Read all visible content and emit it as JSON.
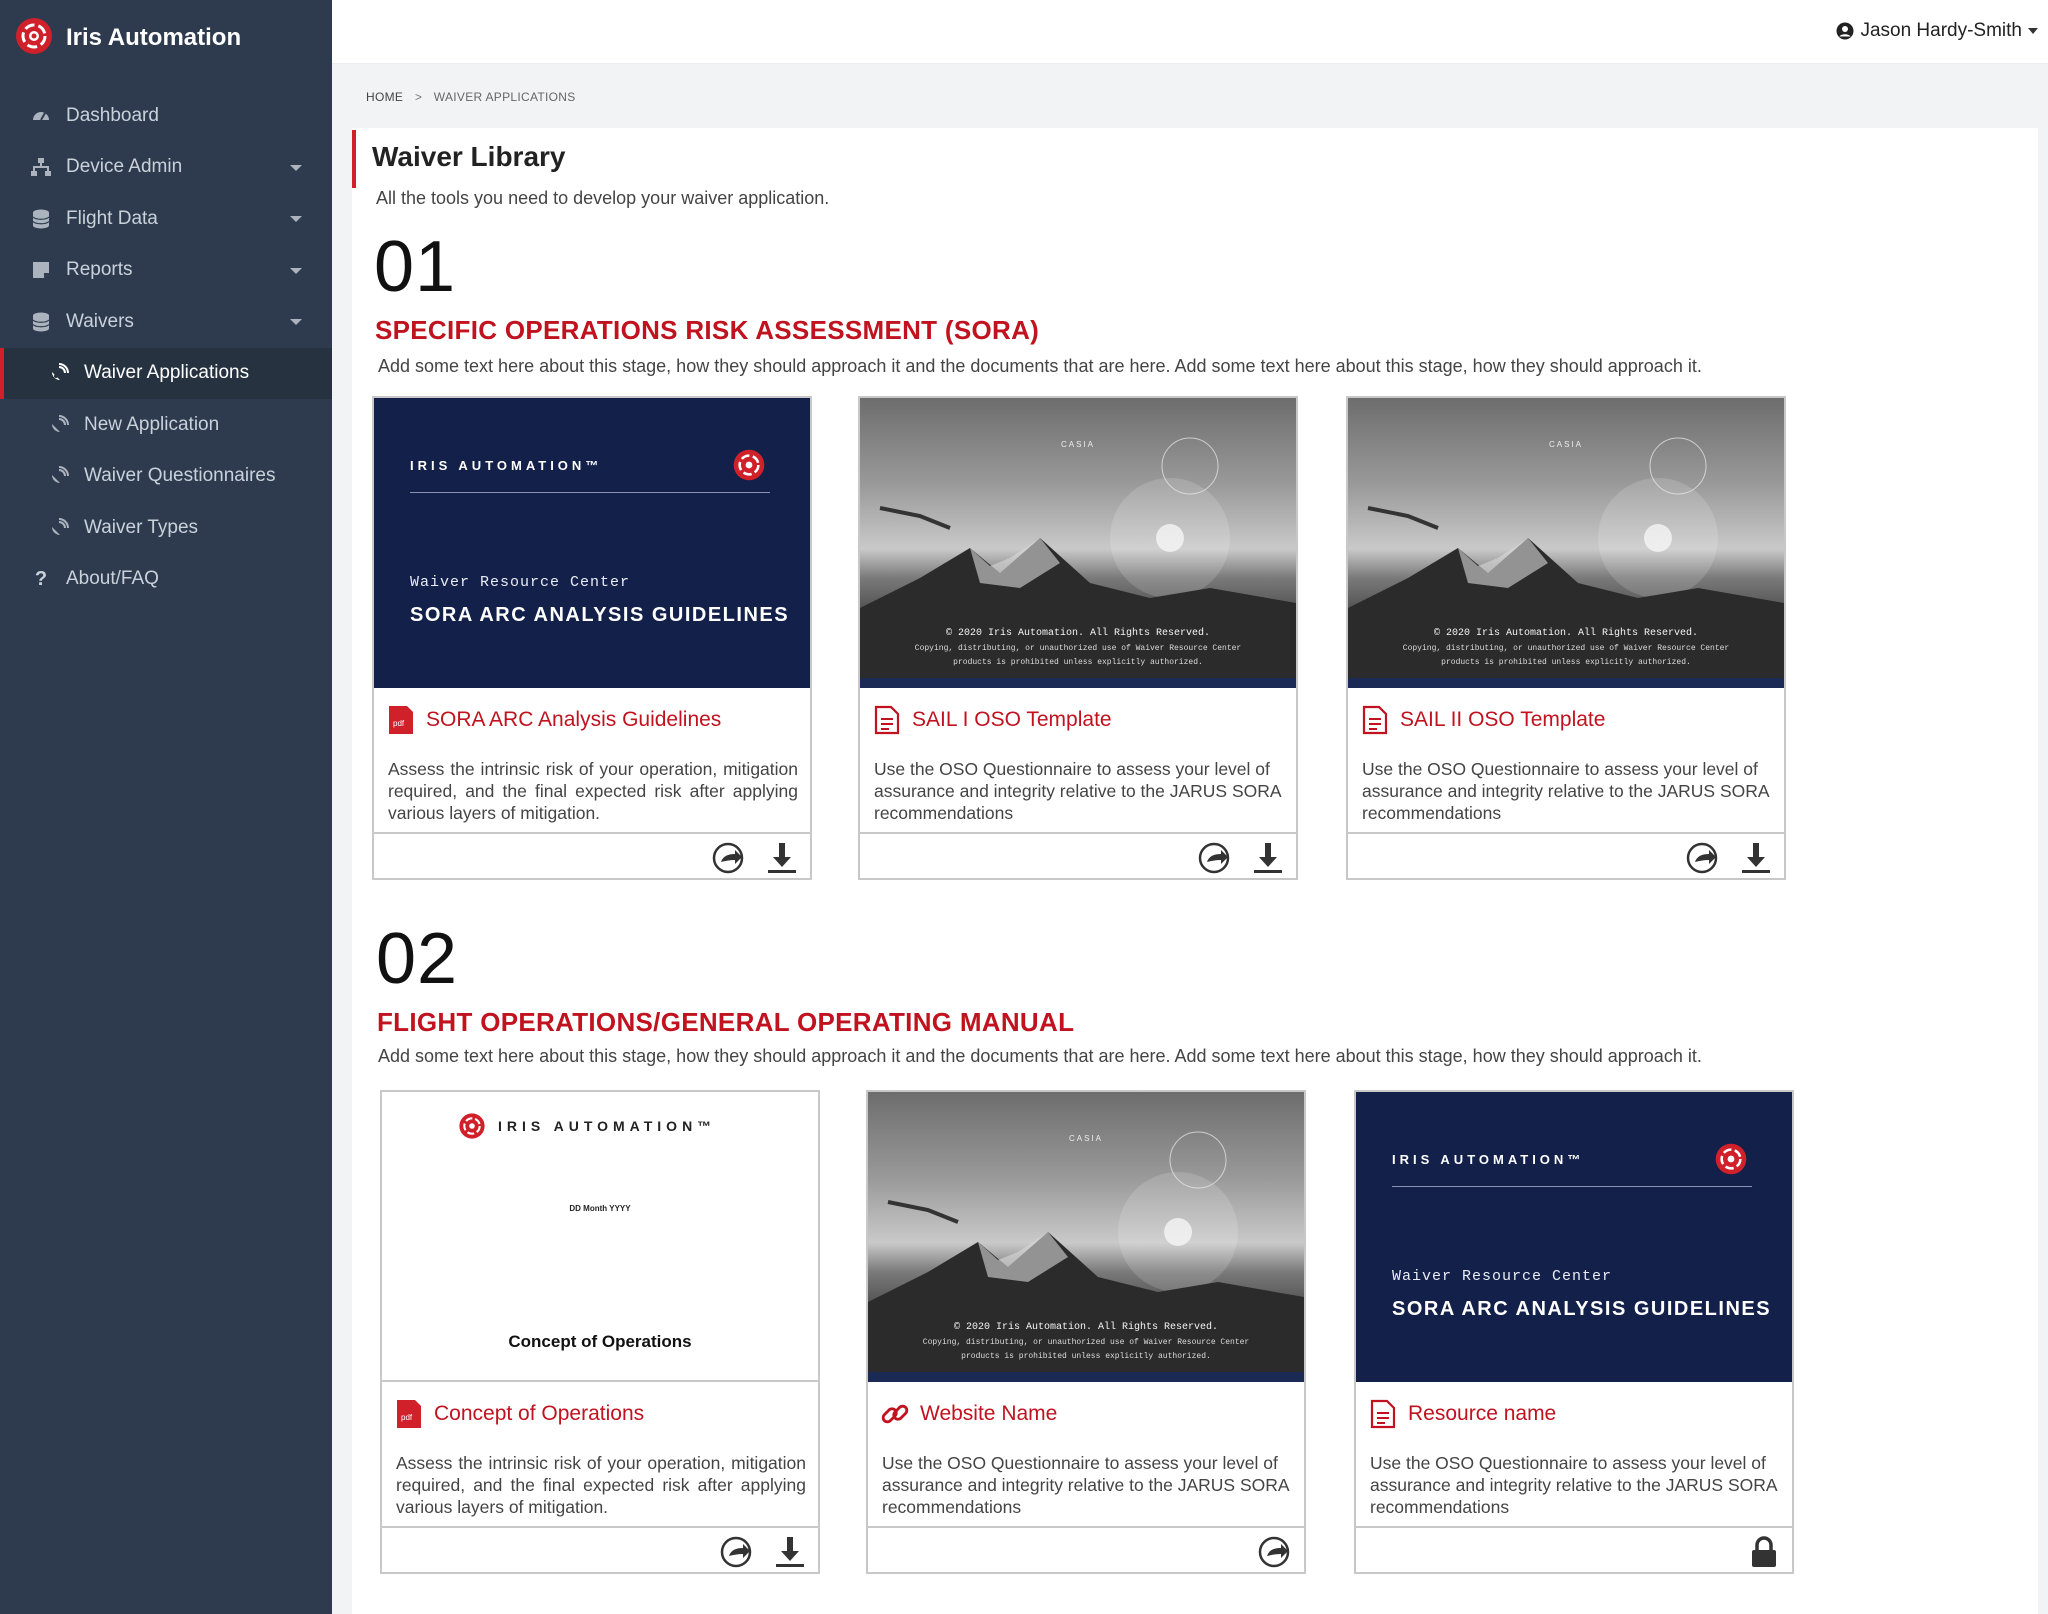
{
  "app": {
    "name": "Iris Automation"
  },
  "user": {
    "name": "Jason Hardy-Smith"
  },
  "sidebar": {
    "items": [
      {
        "label": "Dashboard"
      },
      {
        "label": "Device Admin"
      },
      {
        "label": "Flight Data"
      },
      {
        "label": "Reports"
      },
      {
        "label": "Waivers"
      },
      {
        "label": "Waiver Applications"
      },
      {
        "label": "New Application"
      },
      {
        "label": "Waiver Questionnaires"
      },
      {
        "label": "Waiver Types"
      },
      {
        "label": "About/FAQ"
      }
    ]
  },
  "breadcrumb": {
    "home": "HOME",
    "sep": ">",
    "current": "WAIVER APPLICATIONS"
  },
  "page": {
    "title": "Waiver Library",
    "subtitle": "All the tools you need to develop your waiver application."
  },
  "stages": [
    {
      "num": "01",
      "title": "SPECIFIC OPERATIONS RISK ASSESSMENT (SORA)",
      "desc": "Add some text here about this stage, how they should approach it and the documents that are here. Add some text here about this stage, how they should approach it.",
      "cards": [
        {
          "title": "SORA ARC Analysis Guidelines",
          "desc": "Assess the intrinsic risk of your operation, mitigation required, and the final expected risk after applying various layers of mitigation.",
          "thumb": {
            "brand": "IRIS AUTOMATION™",
            "resource": "Waiver Resource Center",
            "heading": "SORA ARC ANALYSIS GUIDELINES"
          }
        },
        {
          "title": "SAIL I OSO Template",
          "desc": "Use the OSO Questionnaire to assess your level of assurance and integrity relative to the JARUS SORA recommendations",
          "thumb": {
            "copyright": "© 2020 Iris Automation. All Rights Reserved.",
            "line2": "Copying, distributing, or unauthorized use of Waiver Resource Center",
            "line3": "products is prohibited unless explicitly authorized.",
            "casia": "CASIA"
          }
        },
        {
          "title": "SAIL II OSO Template",
          "desc": "Use the OSO Questionnaire to assess your level of assurance and integrity relative to the JARUS SORA recommendations",
          "thumb": {
            "copyright": "© 2020 Iris Automation. All Rights Reserved.",
            "line2": "Copying, distributing, or unauthorized use of Waiver Resource Center",
            "line3": "products is prohibited unless explicitly authorized.",
            "casia": "CASIA"
          }
        }
      ]
    },
    {
      "num": "02",
      "title": "FLIGHT OPERATIONS/GENERAL OPERATING MANUAL",
      "desc": "Add some text here about this stage, how they should approach it and the documents that are here. Add some text here about this stage, how they should approach it.",
      "cards": [
        {
          "title": "Concept of Operations",
          "desc": "Assess the intrinsic risk of your operation, mitigation required, and the final expected risk after applying various layers of mitigation.",
          "thumb": {
            "brand": "IRIS AUTOMATION™",
            "date": "DD Month YYYY",
            "heading": "Concept of Operations"
          }
        },
        {
          "title": "Website Name",
          "desc": "Use the OSO Questionnaire to assess your level of assurance and integrity relative to the JARUS SORA recommendations",
          "thumb": {
            "copyright": "© 2020 Iris Automation. All Rights Reserved.",
            "line2": "Copying, distributing, or unauthorized use of Waiver Resource Center",
            "line3": "products is prohibited unless explicitly authorized.",
            "casia": "CASIA"
          }
        },
        {
          "title": "Resource name",
          "desc": "Use the OSO Questionnaire to assess your level of assurance and integrity relative to the JARUS SORA recommendations",
          "thumb": {
            "brand": "IRIS AUTOMATION™",
            "resource": "Waiver Resource Center",
            "heading": "SORA ARC ANALYSIS GUIDELINES"
          }
        }
      ]
    }
  ],
  "icons": {
    "brand": "iris-logo-icon",
    "dashboard": "gauge-icon",
    "device": "sitemap-icon",
    "data": "database-icon",
    "reports": "note-icon",
    "waivers": "database-icon",
    "sub": "satellite-dish-icon",
    "faq": "question-icon",
    "user": "user-circle-icon",
    "pdf": "pdf-file-icon",
    "doc": "document-icon",
    "link": "link-icon",
    "share": "share-icon",
    "download": "download-icon",
    "lock": "lock-icon"
  },
  "colors": {
    "sidebar": "#2e3b4e",
    "accent": "#d0202a",
    "title": "#c0121f",
    "navy": "#12204a"
  }
}
